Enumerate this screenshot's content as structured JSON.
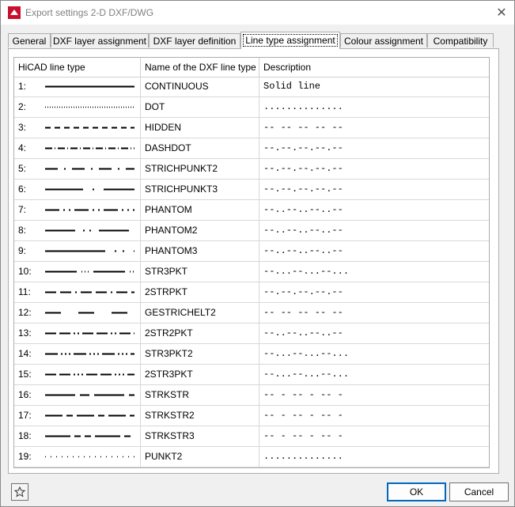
{
  "window": {
    "title": "Export settings 2-D DXF/DWG"
  },
  "tabs": [
    {
      "label": "General"
    },
    {
      "label": "DXF layer assignment"
    },
    {
      "label": "DXF layer definition"
    },
    {
      "label": "Line type assignment"
    },
    {
      "label": "Colour assignment"
    },
    {
      "label": "Compatibility"
    }
  ],
  "active_tab": "Line type assignment",
  "table": {
    "headers": [
      "HiCAD line type",
      "Name of the DXF line type",
      "Description"
    ],
    "rows": [
      {
        "num": "1:",
        "name": "CONTINUOUS",
        "desc": "Solid line",
        "pattern": []
      },
      {
        "num": "2:",
        "name": "DOT",
        "desc": "..............",
        "pattern": [
          1,
          2
        ]
      },
      {
        "num": "3:",
        "name": "HIDDEN",
        "desc": "-- -- -- -- --",
        "pattern": [
          7,
          5
        ]
      },
      {
        "num": "4:",
        "name": "DASHDOT",
        "desc": "--.--.--.--.--",
        "pattern": [
          9,
          3,
          1,
          3
        ]
      },
      {
        "num": "5:",
        "name": "STRICHPUNKT2",
        "desc": "--.--.--.--.--",
        "pattern": [
          16,
          8,
          2,
          8
        ]
      },
      {
        "num": "6:",
        "name": "STRICHPUNKT3",
        "desc": "--.--.--.--.--",
        "pattern": [
          48,
          12,
          2,
          12
        ]
      },
      {
        "num": "7:",
        "name": "PHANTOM",
        "desc": "--..--..--..--",
        "pattern": [
          18,
          5,
          2,
          5,
          2,
          5
        ]
      },
      {
        "num": "8:",
        "name": "PHANTOM2",
        "desc": "--..--..--..--",
        "pattern": [
          38,
          10,
          2,
          6,
          2,
          10
        ]
      },
      {
        "num": "9:",
        "name": "PHANTOM3",
        "desc": "--..--..--..--",
        "pattern": [
          76,
          12,
          2,
          8,
          2,
          12
        ]
      },
      {
        "num": "10:",
        "name": "STR3PKT",
        "desc": "--...--...--...",
        "pattern": [
          40,
          6,
          1,
          3,
          1,
          3,
          1,
          6
        ]
      },
      {
        "num": "11:",
        "name": "2STRPKT",
        "desc": "--.--.--.--.--",
        "pattern": [
          14,
          5,
          14,
          5,
          2,
          5
        ]
      },
      {
        "num": "12:",
        "name": "GESTRICHELT2",
        "desc": "-- -- -- -- --",
        "pattern": [
          20,
          22
        ]
      },
      {
        "num": "13:",
        "name": "2STR2PKT",
        "desc": "--..--..--..--",
        "pattern": [
          14,
          4,
          14,
          4,
          2,
          3,
          2,
          4
        ]
      },
      {
        "num": "14:",
        "name": "STR3PKT2",
        "desc": "--...--...--...",
        "pattern": [
          16,
          4,
          2,
          3,
          2,
          3,
          2,
          4
        ]
      },
      {
        "num": "15:",
        "name": "2STR3PKT",
        "desc": "--...--...--...",
        "pattern": [
          14,
          4,
          14,
          4,
          2,
          3,
          2,
          3,
          2,
          4
        ]
      },
      {
        "num": "16:",
        "name": "STRKSTR",
        "desc": "-- - -- - -- -",
        "pattern": [
          38,
          6,
          12,
          6
        ]
      },
      {
        "num": "17:",
        "name": "STRKSTR2",
        "desc": "-- - -- - -- -",
        "pattern": [
          22,
          5,
          8,
          5
        ]
      },
      {
        "num": "18:",
        "name": "STRKSTR3",
        "desc": "-- - -- - -- -",
        "pattern": [
          32,
          5,
          8,
          5,
          8,
          5
        ]
      },
      {
        "num": "19:",
        "name": "PUNKT2",
        "desc": "..............",
        "pattern": [
          1,
          6
        ]
      }
    ]
  },
  "buttons": {
    "ok": "OK",
    "cancel": "Cancel"
  },
  "icons": {
    "app": "hicad-logo-icon",
    "close": "close-icon",
    "favorite": "star-icon"
  },
  "colors": {
    "accent": "#0067c0",
    "logo": "#c8102e"
  }
}
